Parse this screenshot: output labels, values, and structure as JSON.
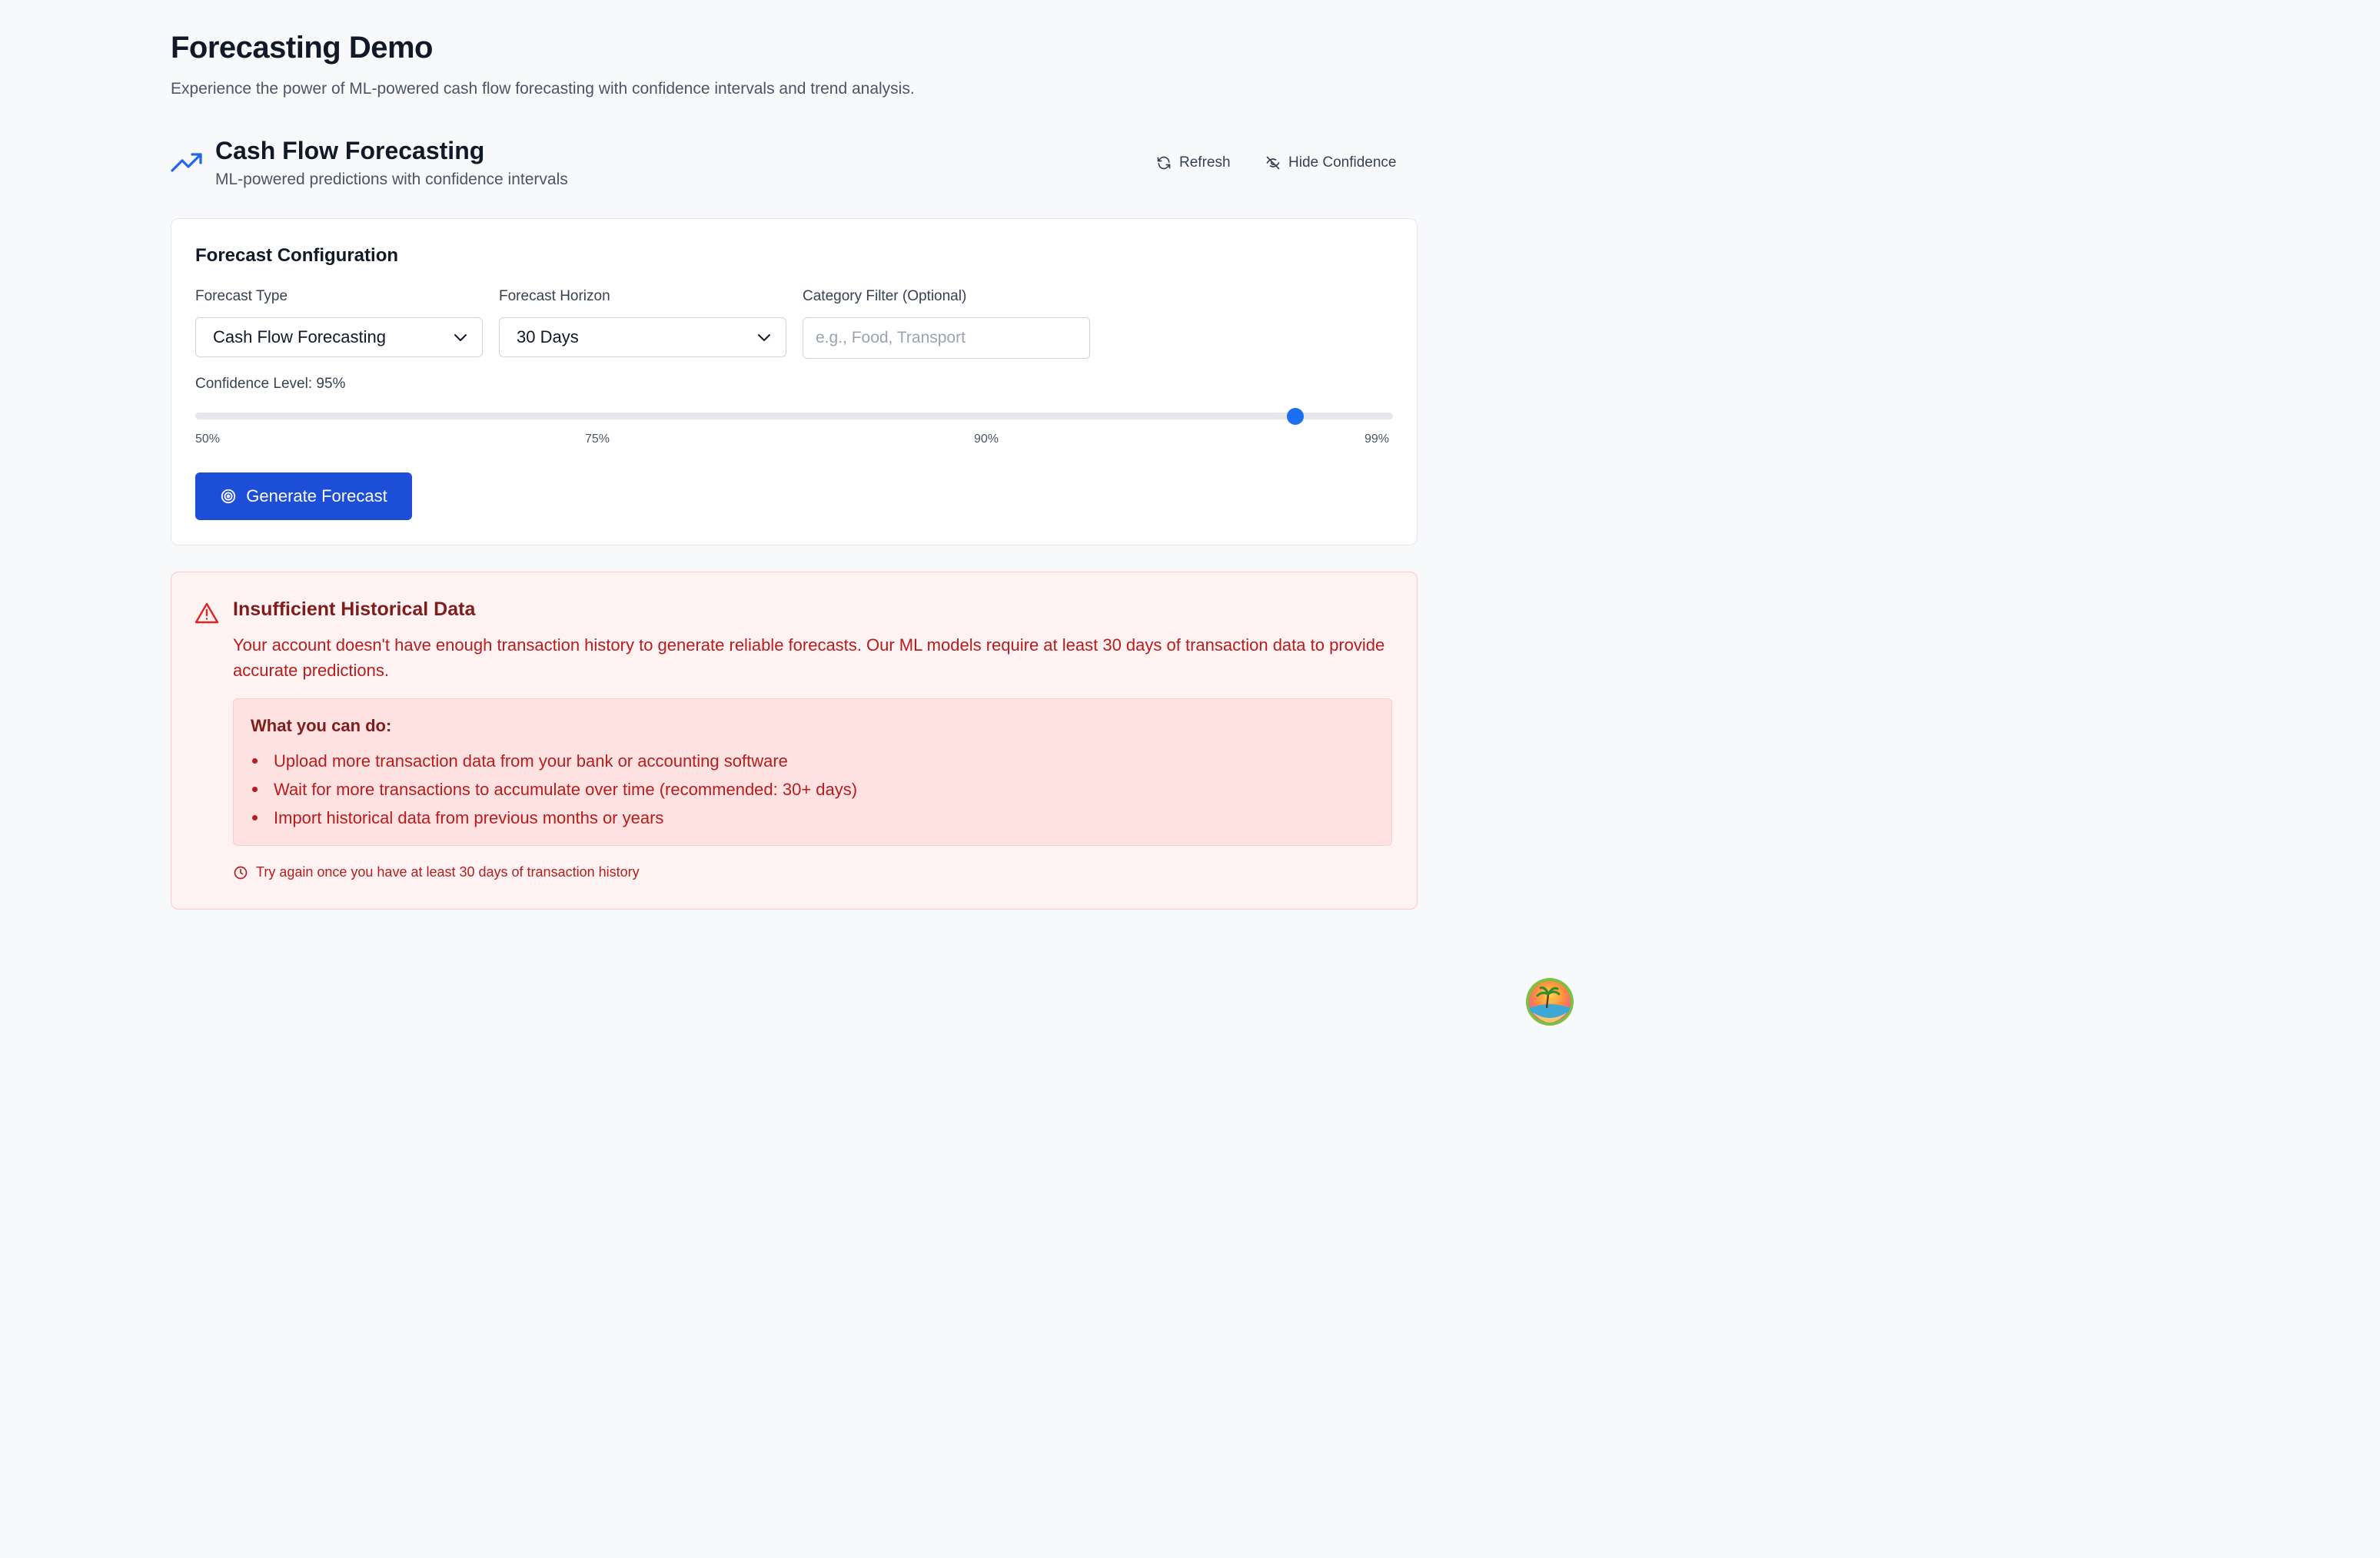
{
  "page": {
    "title": "Forecasting Demo",
    "subtitle": "Experience the power of ML-powered cash flow forecasting with confidence intervals and trend analysis."
  },
  "section": {
    "icon": "trending-up-icon",
    "title": "Cash Flow Forecasting",
    "subtitle": "ML-powered predictions with confidence intervals",
    "refresh_label": "Refresh",
    "hide_confidence_label": "Hide Confidence"
  },
  "config": {
    "title": "Forecast Configuration",
    "forecast_type": {
      "label": "Forecast Type",
      "value": "Cash Flow Forecasting"
    },
    "forecast_horizon": {
      "label": "Forecast Horizon",
      "value": "30 Days"
    },
    "category_filter": {
      "label": "Category Filter (Optional)",
      "placeholder": "e.g., Food, Transport",
      "value": ""
    },
    "confidence": {
      "label": "Confidence Level: 95%",
      "value_percent": 95,
      "ticks": [
        "50%",
        "75%",
        "90%",
        "99%"
      ]
    },
    "generate_label": "Generate Forecast"
  },
  "error": {
    "title": "Insufficient Historical Data",
    "message": "Your account doesn't have enough transaction history to generate reliable forecasts. Our ML models require at least 30 days of transaction data to provide accurate predictions.",
    "tips_heading": "What you can do:",
    "tips": [
      "Upload more transaction data from your bank or accounting software",
      "Wait for more transactions to accumulate over time (recommended: 30+ days)",
      "Import historical data from previous months or years"
    ],
    "retry_note": "Try again once you have at least 30 days of transaction history"
  },
  "colors": {
    "accent": "#1d4ed8",
    "slider_thumb": "#1d6ff2",
    "error_text": "#b91c1c",
    "error_title": "#7f1d1d",
    "error_bg": "#fef2f2"
  }
}
